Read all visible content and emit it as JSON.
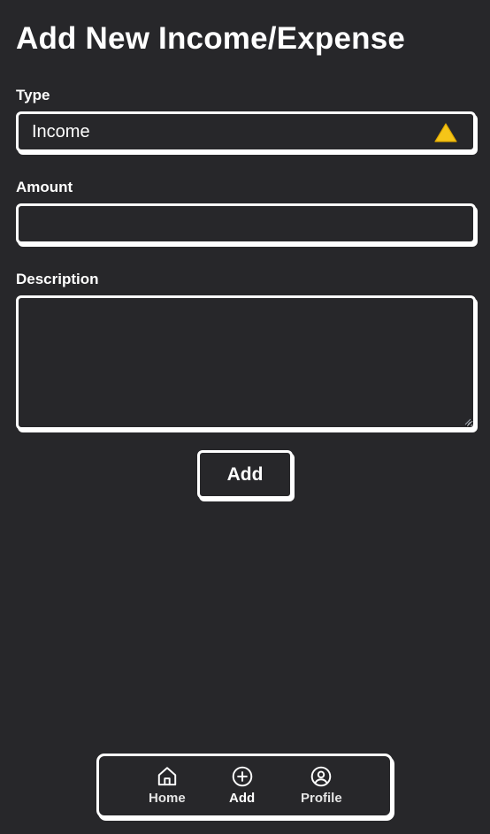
{
  "page": {
    "title": "Add New Income/Expense"
  },
  "form": {
    "type_label": "Type",
    "type_value": "Income",
    "type_icon": "warning-icon",
    "amount_label": "Amount",
    "amount_value": "",
    "description_label": "Description",
    "description_value": "",
    "submit_label": "Add"
  },
  "nav": {
    "items": [
      {
        "label": "Home",
        "icon": "home-icon",
        "active": false
      },
      {
        "label": "Add",
        "icon": "plus-circle-icon",
        "active": true
      },
      {
        "label": "Profile",
        "icon": "user-circle-icon",
        "active": false
      }
    ]
  },
  "colors": {
    "background": "#27272a",
    "foreground": "#ffffff",
    "warning": "#f5c518"
  }
}
